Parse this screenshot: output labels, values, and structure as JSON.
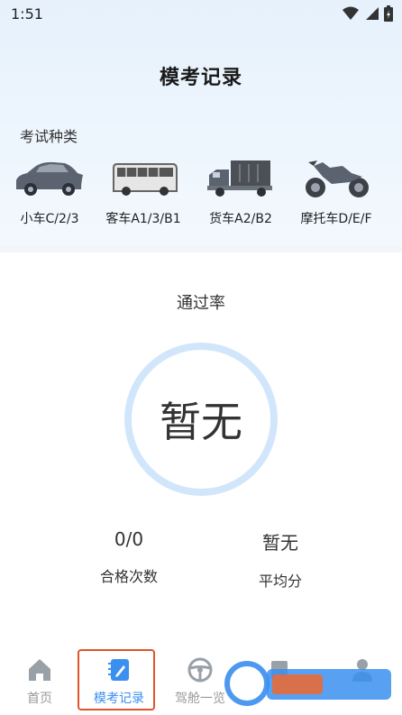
{
  "status_bar": {
    "time": "1:51"
  },
  "header": {
    "title": "模考记录"
  },
  "exam_types": {
    "label": "考试种类",
    "items": [
      {
        "label": "小车C/2/3",
        "icon": "car-icon"
      },
      {
        "label": "客车A1/3/B1",
        "icon": "bus-icon"
      },
      {
        "label": "货车A2/B2",
        "icon": "truck-icon"
      },
      {
        "label": "摩托车D/E/F",
        "icon": "motorcycle-icon"
      }
    ]
  },
  "pass_rate": {
    "title": "通过率",
    "value": "暂无"
  },
  "stats": {
    "passed": {
      "value": "0/0",
      "label": "合格次数"
    },
    "average": {
      "value": "暂无",
      "label": "平均分"
    }
  },
  "tabbar": {
    "items": [
      {
        "label": "首页",
        "icon": "home-icon"
      },
      {
        "label": "模考记录",
        "icon": "notebook-icon",
        "active": true
      },
      {
        "label": "驾舱一览",
        "icon": "steering-wheel-icon"
      },
      {
        "label": "",
        "icon": "bookmark-icon"
      },
      {
        "label": "",
        "icon": "user-icon"
      }
    ]
  },
  "colors": {
    "accent": "#3a8ff0",
    "highlight": "#e0542c",
    "ring": "#d2e6fb"
  }
}
